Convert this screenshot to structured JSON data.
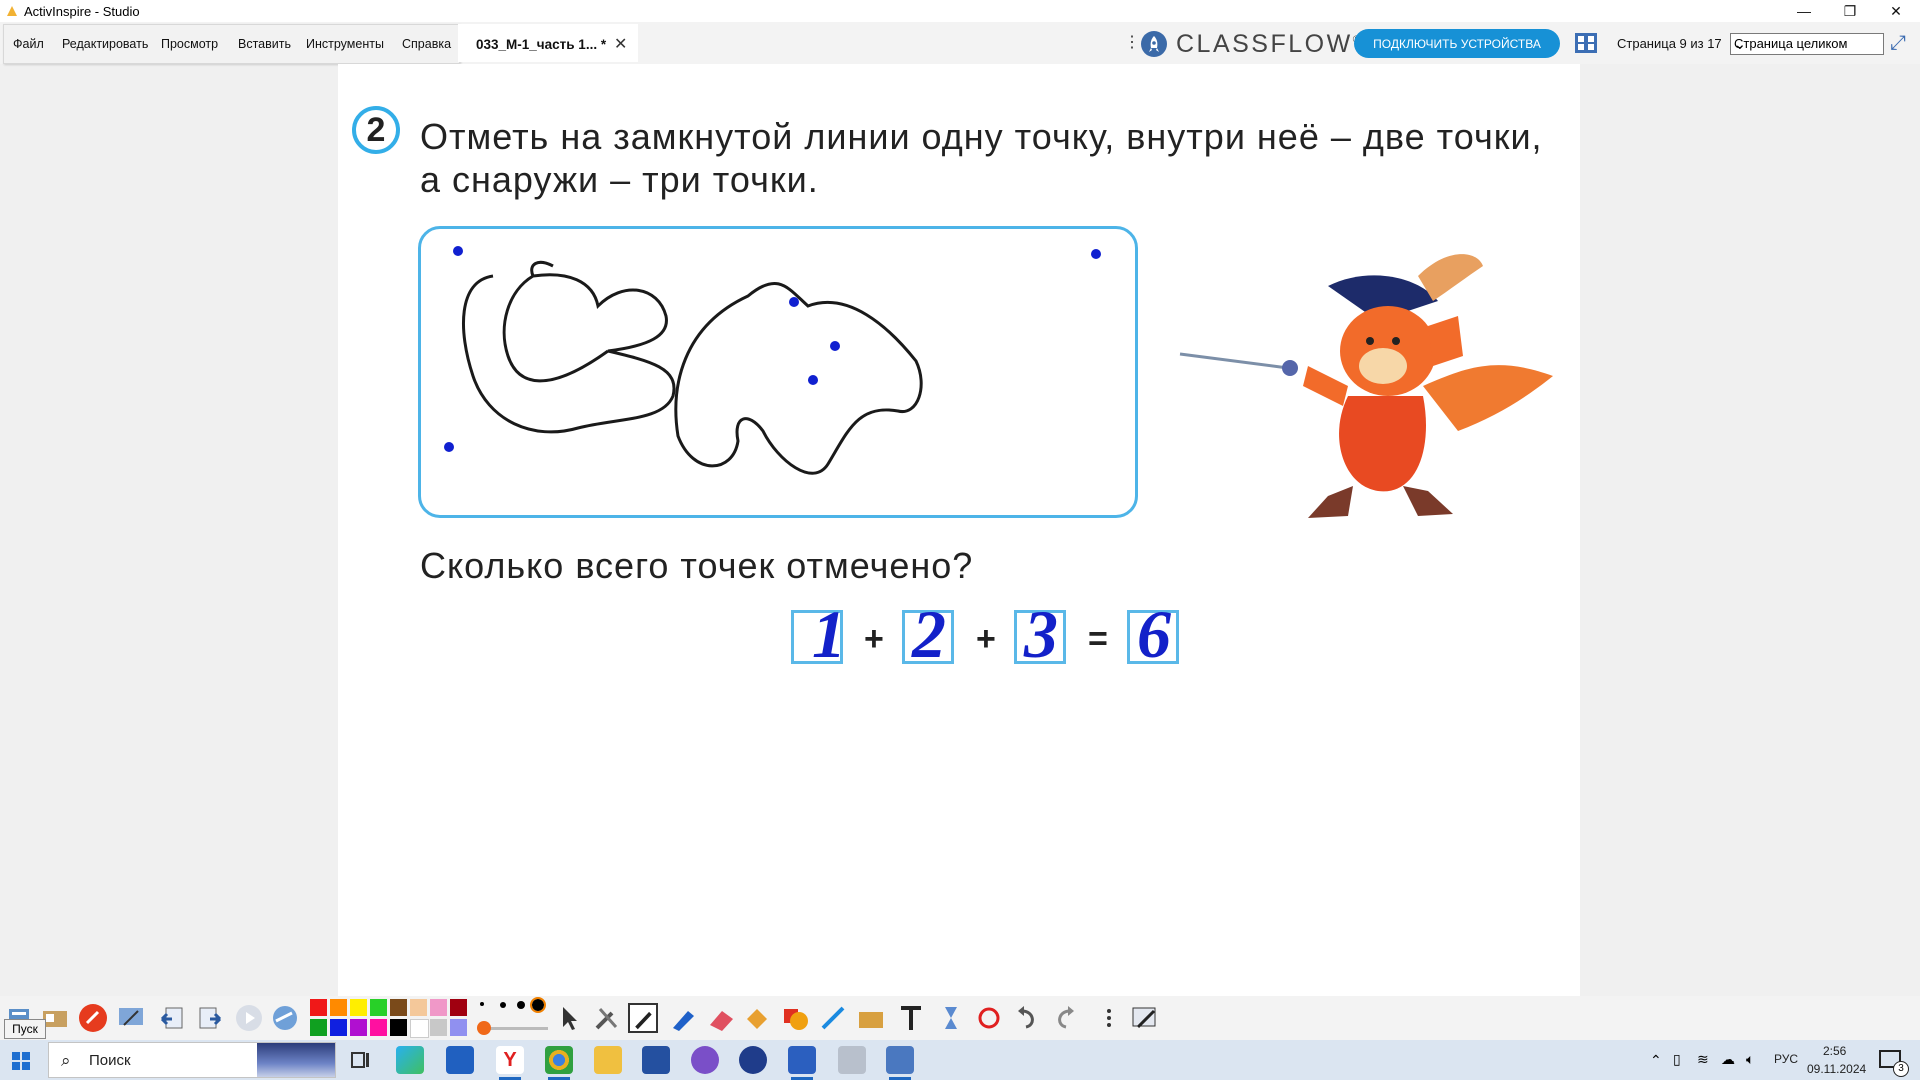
{
  "window": {
    "title": "ActivInspire - Studio",
    "minimize": "—",
    "restore": "❐",
    "close": "✕"
  },
  "menu": {
    "items": [
      "Файл",
      "Редактировать",
      "Просмотр",
      "Вставить",
      "Инструменты",
      "Справка"
    ]
  },
  "document_tab": {
    "label": "033_М-1_часть 1... *",
    "close": "✕"
  },
  "toolbar": {
    "kebab": "⋮",
    "brand": "CLASSFLOW",
    "brand_mark": "®",
    "connect_label": "ПОДКЛЮЧИТЬ УСТРОЙСТВА",
    "page_counter": "Страница 9 из 17",
    "zoom_value": "Страница целиком",
    "fullscreen": "⤢"
  },
  "flipchart": {
    "task_number": "2",
    "task_line1": "Отметь на замкнутой линии одну точку, внутри неё – две точки,",
    "task_line2": "а снаружи – три точки.",
    "question": "Сколько всего точек отмечено?",
    "equation": {
      "answers": [
        "1",
        "2",
        "3",
        "6"
      ],
      "ops": [
        "+",
        "+",
        "="
      ]
    }
  },
  "palette": {
    "colors": [
      "#f01818",
      "#ff8a00",
      "#ffee00",
      "#28d028",
      "#7a4a1a",
      "#f4c89a",
      "#f098c8",
      "#a00010",
      "#10a020",
      "#1020e0",
      "#b010d0",
      "#ff10a0",
      "#000000",
      "#ffffff",
      "#c8c8c8",
      "#9090f0"
    ]
  },
  "start_tooltip": "Пуск",
  "taskbar": {
    "search_placeholder": "Поиск",
    "language": "РУС",
    "time": "2:56",
    "date": "09.11.2024",
    "notification_count": "3"
  }
}
